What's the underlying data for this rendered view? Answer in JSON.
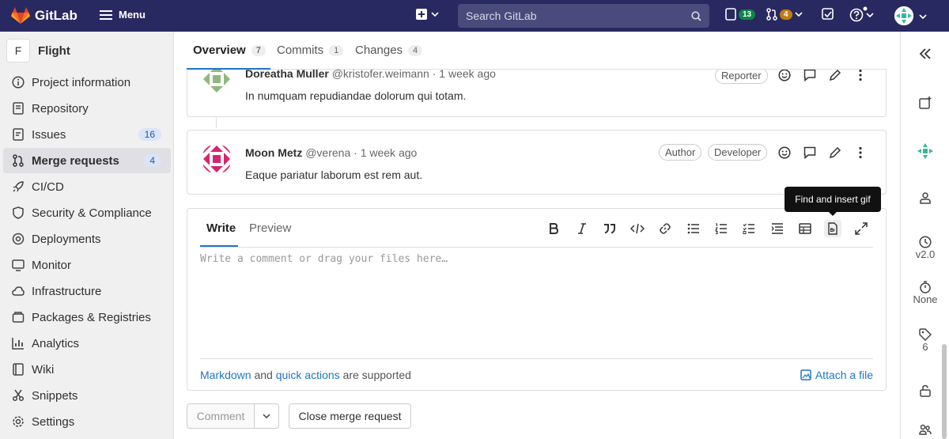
{
  "topbar": {
    "logo_text": "GitLab",
    "menu_label": "Menu",
    "search_placeholder": "Search GitLab",
    "issues_count": "13",
    "mr_count": "4"
  },
  "sidebar": {
    "project_initial": "F",
    "project_name": "Flight",
    "items": [
      {
        "label": "Project information",
        "icon": "info-icon"
      },
      {
        "label": "Repository",
        "icon": "repository-icon"
      },
      {
        "label": "Issues",
        "icon": "issues-icon",
        "count": "16"
      },
      {
        "label": "Merge requests",
        "icon": "merge-request-icon",
        "count": "4",
        "active": true
      },
      {
        "label": "CI/CD",
        "icon": "rocket-icon"
      },
      {
        "label": "Security & Compliance",
        "icon": "shield-icon"
      },
      {
        "label": "Deployments",
        "icon": "deployments-icon"
      },
      {
        "label": "Monitor",
        "icon": "monitor-icon"
      },
      {
        "label": "Infrastructure",
        "icon": "cloud-icon"
      },
      {
        "label": "Packages & Registries",
        "icon": "package-icon"
      },
      {
        "label": "Analytics",
        "icon": "chart-icon"
      },
      {
        "label": "Wiki",
        "icon": "book-icon"
      },
      {
        "label": "Snippets",
        "icon": "snippet-icon"
      },
      {
        "label": "Settings",
        "icon": "gear-icon"
      }
    ]
  },
  "tabs": [
    {
      "label": "Overview",
      "count": "7"
    },
    {
      "label": "Commits",
      "count": "1"
    },
    {
      "label": "Changes",
      "count": "4"
    }
  ],
  "notes": [
    {
      "author": "Doreatha Muller",
      "username": "@kristofer.weimann",
      "time": "· 1 week ago",
      "roles": [
        "Reporter"
      ],
      "body": "In numquam repudiandae dolorum qui totam.",
      "avatar_color": "#8fb87a"
    },
    {
      "author": "Moon Metz",
      "username": "@verena",
      "time": "· 1 week ago",
      "roles": [
        "Author",
        "Developer"
      ],
      "body": "Eaque pariatur laborum est rem aut.",
      "avatar_color": "#d6246e"
    }
  ],
  "comment_box": {
    "write_tab": "Write",
    "preview_tab": "Preview",
    "placeholder": "Write a comment or drag your files here…",
    "markdown_link": "Markdown",
    "and_text": "and",
    "quick_actions_link": "quick actions",
    "supported_text": "are supported",
    "attach_label": "Attach a file",
    "tooltip": "Find and insert gif"
  },
  "buttons": {
    "comment": "Comment",
    "close_mr": "Close merge request"
  },
  "right_sidebar": {
    "milestone": "v2.0",
    "time_tracking": "None",
    "labels_count": "6"
  },
  "colors": {
    "topbar": "#292961",
    "accent": "#1f75cb"
  }
}
